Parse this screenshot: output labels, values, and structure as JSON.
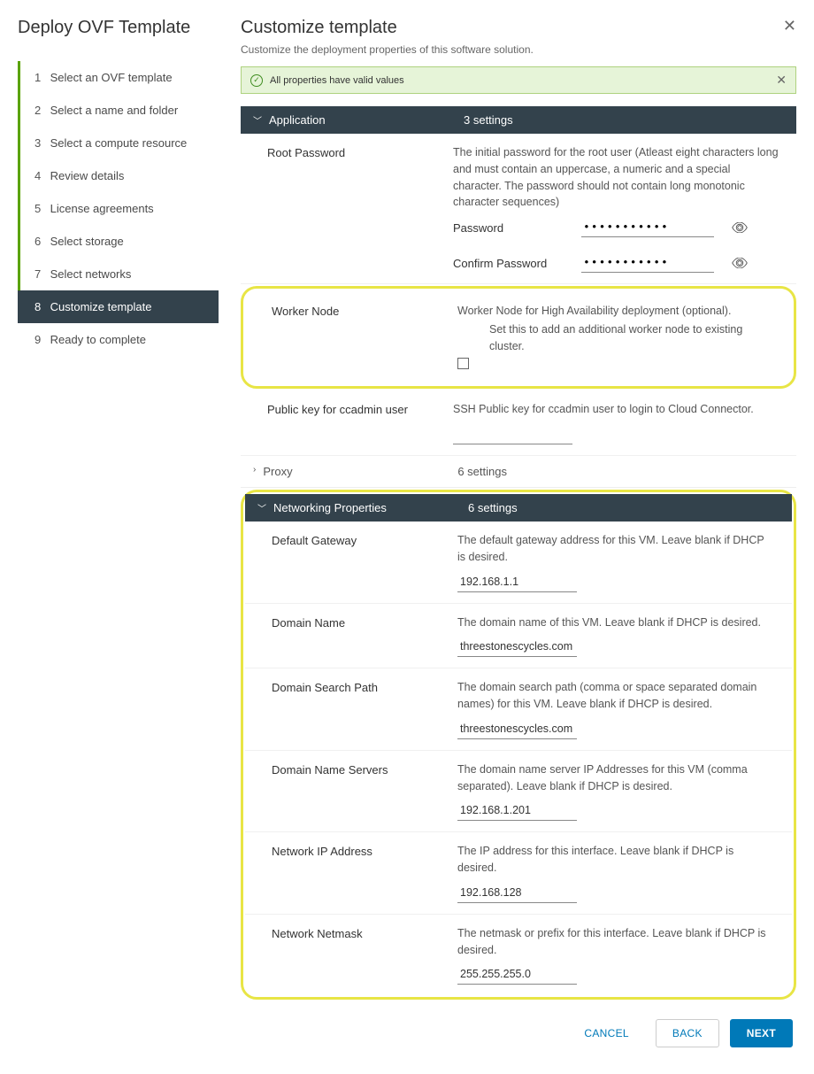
{
  "sidebar": {
    "title": "Deploy OVF Template",
    "steps": [
      {
        "num": "1",
        "label": "Select an OVF template",
        "state": "completed"
      },
      {
        "num": "2",
        "label": "Select a name and folder",
        "state": "completed"
      },
      {
        "num": "3",
        "label": "Select a compute resource",
        "state": "completed"
      },
      {
        "num": "4",
        "label": "Review details",
        "state": "completed"
      },
      {
        "num": "5",
        "label": "License agreements",
        "state": "completed"
      },
      {
        "num": "6",
        "label": "Select storage",
        "state": "completed"
      },
      {
        "num": "7",
        "label": "Select networks",
        "state": "completed"
      },
      {
        "num": "8",
        "label": "Customize template",
        "state": "active"
      },
      {
        "num": "9",
        "label": "Ready to complete",
        "state": ""
      }
    ]
  },
  "main": {
    "title": "Customize template",
    "subtitle": "Customize the deployment properties of this software solution.",
    "valid_msg": "All properties have valid values"
  },
  "sections": {
    "application": {
      "name": "Application",
      "count": "3 settings"
    },
    "proxy": {
      "name": "Proxy",
      "count": "6 settings"
    },
    "networking": {
      "name": "Networking Properties",
      "count": "6 settings"
    }
  },
  "app": {
    "root_pw": {
      "label": "Root Password",
      "desc": "The initial password for the root user (Atleast eight characters long and must contain an uppercase, a numeric and a special character. The password should not contain long monotonic character sequences)",
      "pw_label": "Password",
      "pw_value": "•••••••••••",
      "confirm_label": "Confirm Password",
      "confirm_value": "•••••••••••"
    },
    "worker": {
      "label": "Worker Node",
      "desc": "Worker Node for High Availability deployment (optional).",
      "desc2": "Set this to add an additional worker node to existing cluster."
    },
    "pubkey": {
      "label": "Public key for ccadmin user",
      "desc": "SSH Public key for ccadmin user to login to Cloud Connector.",
      "value": ""
    }
  },
  "net": {
    "gateway": {
      "label": "Default Gateway",
      "desc": "The default gateway address for this VM. Leave blank if DHCP is desired.",
      "value": "192.168.1.1"
    },
    "domain": {
      "label": "Domain Name",
      "desc": "The domain name of this VM. Leave blank if DHCP is desired.",
      "value": "threestonescycles.com"
    },
    "search": {
      "label": "Domain Search Path",
      "desc": "The domain search path (comma or space separated domain names) for this VM. Leave blank if DHCP is desired.",
      "value": "threestonescycles.com"
    },
    "dns": {
      "label": "Domain Name Servers",
      "desc": "The domain name server IP Addresses for this VM (comma separated). Leave blank if DHCP is desired.",
      "value": "192.168.1.201"
    },
    "ip": {
      "label": "Network IP Address",
      "desc": "The IP address for this interface. Leave blank if DHCP is desired.",
      "value": "192.168.128"
    },
    "netmask": {
      "label": "Network Netmask",
      "desc": "The netmask or prefix for this interface. Leave blank if DHCP is desired.",
      "value": "255.255.255.0"
    }
  },
  "footer": {
    "cancel": "CANCEL",
    "back": "BACK",
    "next": "NEXT"
  }
}
